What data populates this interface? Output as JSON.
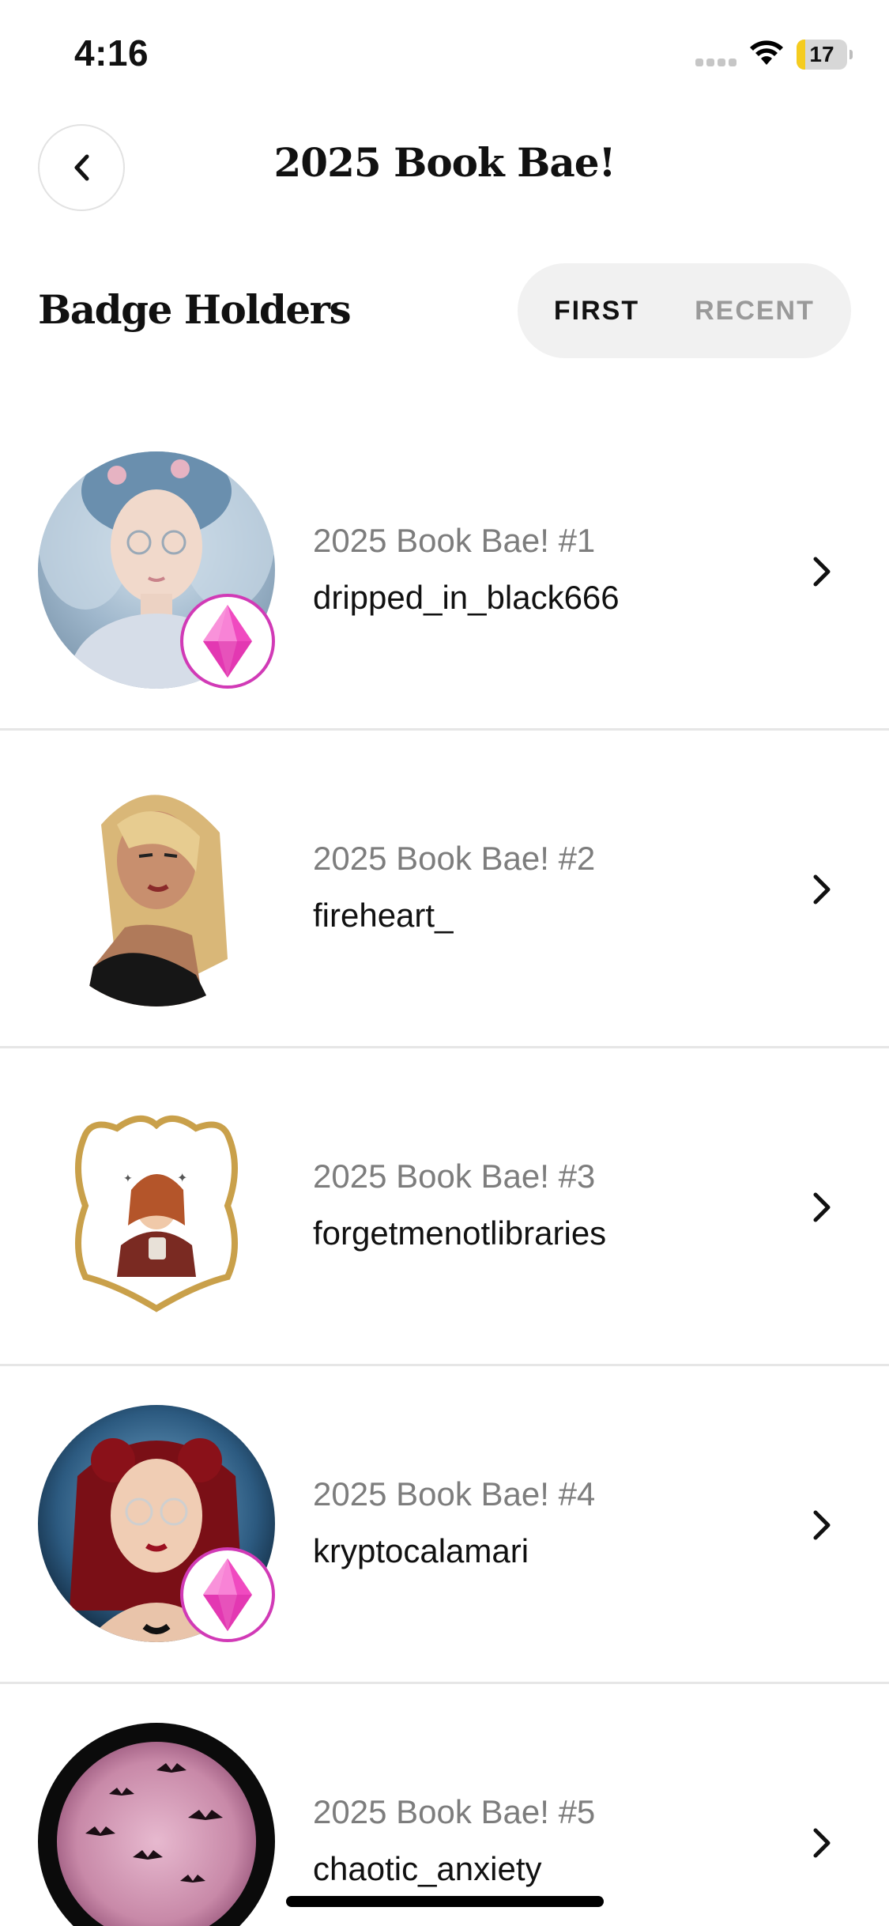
{
  "status_bar": {
    "time": "4:16",
    "battery_level": "17",
    "battery_color": "#f5cc1f",
    "icons": [
      "signal-icon",
      "wifi-icon",
      "battery-icon"
    ]
  },
  "header": {
    "title": "2025 Book Bae!",
    "back_icon": "chevron-left-icon"
  },
  "section": {
    "title": "Badge Holders",
    "tabs": [
      {
        "label": "FIRST",
        "selected": true
      },
      {
        "label": "RECENT",
        "selected": false
      }
    ]
  },
  "holders": [
    {
      "badge_title": "2025 Book Bae! #1",
      "username": "dripped_in_black666",
      "has_gem_badge": true
    },
    {
      "badge_title": "2025 Book Bae! #2",
      "username": "fireheart_",
      "has_gem_badge": false
    },
    {
      "badge_title": "2025 Book Bae! #3",
      "username": "forgetmenotlibraries",
      "has_gem_badge": false
    },
    {
      "badge_title": "2025 Book Bae! #4",
      "username": "kryptocalamari",
      "has_gem_badge": true
    },
    {
      "badge_title": "2025 Book Bae! #5",
      "username": "chaotic_anxiety",
      "has_gem_badge": false
    }
  ],
  "colors": {
    "gem_pink": "#f04ac0",
    "gem_border": "#d13ab6",
    "divider": "#e6e6e6",
    "segment_bg": "#f1f1f1"
  }
}
